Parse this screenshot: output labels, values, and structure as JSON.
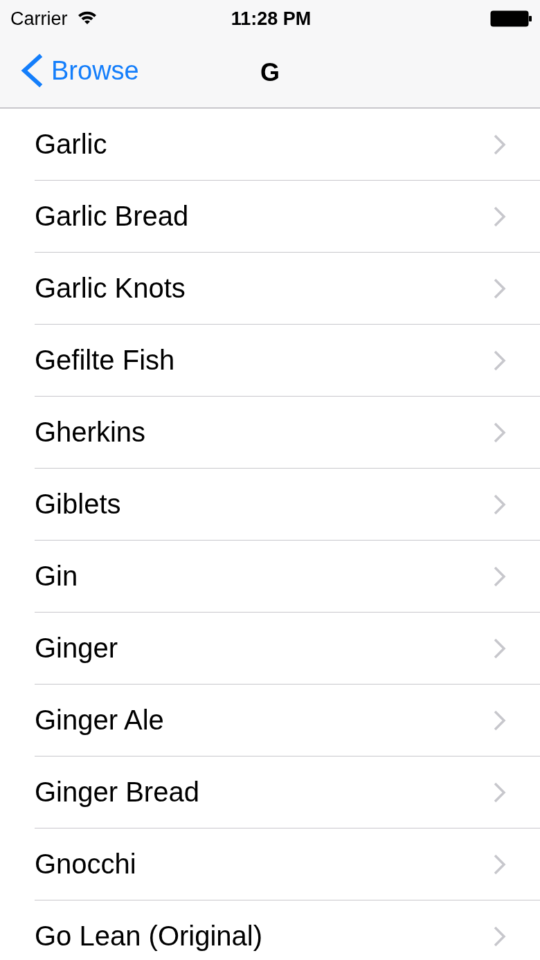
{
  "status_bar": {
    "carrier": "Carrier",
    "time": "11:28 PM"
  },
  "nav_bar": {
    "back_label": "Browse",
    "title": "G"
  },
  "items": [
    {
      "label": "Garlic"
    },
    {
      "label": "Garlic Bread"
    },
    {
      "label": "Garlic Knots"
    },
    {
      "label": "Gefilte Fish"
    },
    {
      "label": "Gherkins"
    },
    {
      "label": "Giblets"
    },
    {
      "label": "Gin"
    },
    {
      "label": "Ginger"
    },
    {
      "label": "Ginger Ale"
    },
    {
      "label": "Ginger Bread"
    },
    {
      "label": "Gnocchi"
    },
    {
      "label": "Go Lean (Original)"
    }
  ]
}
